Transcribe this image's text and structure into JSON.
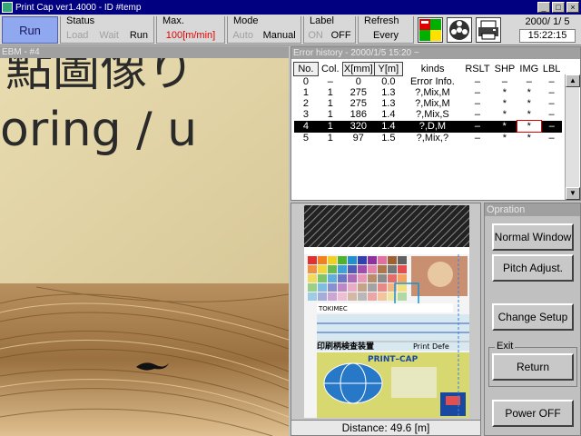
{
  "window": {
    "title": "Print Cap ver1.4000 - ID #temp",
    "min": "_",
    "max": "□",
    "close": "×"
  },
  "toolbar": {
    "run_label": "Run",
    "status": {
      "label": "Status",
      "options": [
        "Load",
        "Wait",
        "Run"
      ]
    },
    "max": {
      "label": "Max.",
      "value": "100[m/min]"
    },
    "mode": {
      "label": "Mode",
      "options": [
        "Auto",
        "Manual"
      ]
    },
    "label_group": {
      "label": "Label",
      "options": [
        "ON",
        "OFF"
      ]
    },
    "refresh": {
      "label": "Refresh",
      "value": "Every"
    },
    "date": "2000/ 1/ 5",
    "time": "15:22:15"
  },
  "camera": {
    "title": "EBM - #4",
    "text_line1": "點圖像り",
    "text_line2": "oring / u"
  },
  "error_history": {
    "title": "Error history - 2000/1/5 15:20 ~",
    "columns": [
      "No.",
      "Col.",
      "X[mm]",
      "Y[m]",
      "kinds",
      "RSLT",
      "SHP",
      "IMG",
      "LBL"
    ],
    "rows": [
      [
        "0",
        "–",
        "0",
        "0.0",
        "Error Info.",
        "–",
        "–",
        "–",
        "–"
      ],
      [
        "1",
        "1",
        "275",
        "1.3",
        "?,Mix,M",
        "–",
        "*",
        "*",
        "–"
      ],
      [
        "2",
        "1",
        "275",
        "1.3",
        "?,Mix,M",
        "–",
        "*",
        "*",
        "–"
      ],
      [
        "3",
        "1",
        "186",
        "1.4",
        "?,Mix,S",
        "–",
        "*",
        "*",
        "–"
      ],
      [
        "4",
        "1",
        "320",
        "1.4",
        "?,D,M",
        "–",
        "*",
        "*",
        "–"
      ],
      [
        "5",
        "1",
        "97",
        "1.5",
        "?,Mix,?",
        "–",
        "*",
        "*",
        "–"
      ]
    ],
    "selected_row": 4
  },
  "pitch_image": {
    "label1": "TOKIMEC",
    "label2": "印刷柄検査装置",
    "label3": "Print Defe",
    "label4": "PRINT–CAP",
    "distance": "Distance: 49.6 [m]"
  },
  "operation": {
    "title": "Opration",
    "normal_window": "Normal Window",
    "pitch_adjust": "Pitch Adjust.",
    "change_setup": "Change Setup",
    "exit_label": "Exit",
    "return": "Return",
    "power_off": "Power OFF"
  },
  "colors": {
    "accent": "#8fa8f0",
    "title_bar": "#000080",
    "selected_row": "#000000",
    "highlight": "#e00000"
  }
}
